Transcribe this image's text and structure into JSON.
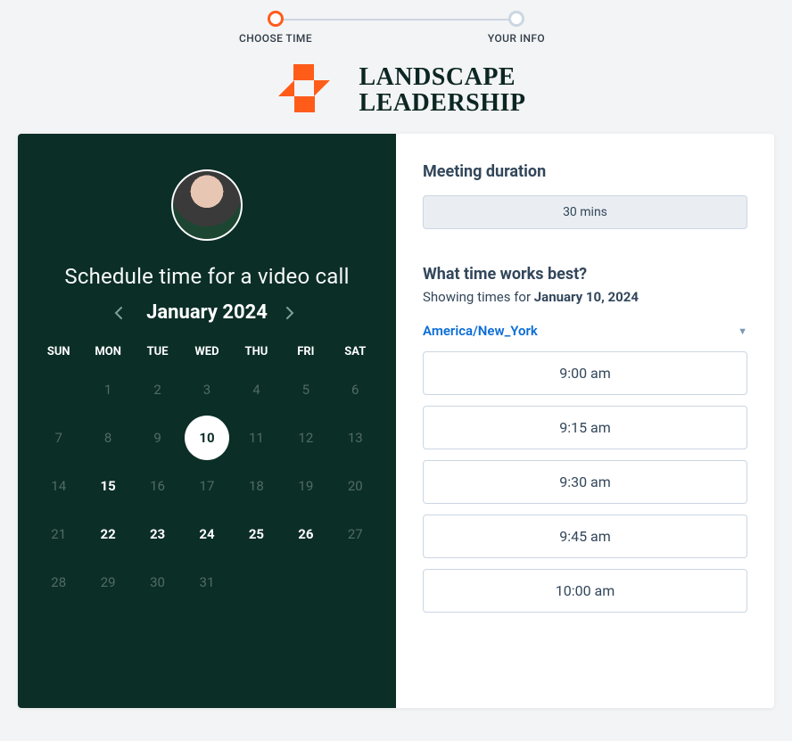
{
  "stepper": {
    "steps": [
      "CHOOSE TIME",
      "YOUR INFO"
    ],
    "active_index": 0
  },
  "brand": {
    "line1": "LANDSCAPE",
    "line2": "LEADERSHIP",
    "accent": "#ff5c1a"
  },
  "left": {
    "heading": "Schedule time for a video call",
    "month_label": "January 2024",
    "weekdays": [
      "SUN",
      "MON",
      "TUE",
      "WED",
      "THU",
      "FRI",
      "SAT"
    ],
    "grid": [
      [
        {
          "n": "",
          "s": ""
        },
        {
          "n": "1",
          "s": "dim"
        },
        {
          "n": "2",
          "s": "dim"
        },
        {
          "n": "3",
          "s": "dim"
        },
        {
          "n": "4",
          "s": "dim"
        },
        {
          "n": "5",
          "s": "dim"
        },
        {
          "n": "6",
          "s": "dim"
        }
      ],
      [
        {
          "n": "7",
          "s": "dim"
        },
        {
          "n": "8",
          "s": "dim"
        },
        {
          "n": "9",
          "s": "dim"
        },
        {
          "n": "10",
          "s": "sel"
        },
        {
          "n": "11",
          "s": "dim"
        },
        {
          "n": "12",
          "s": "dim"
        },
        {
          "n": "13",
          "s": "dim"
        }
      ],
      [
        {
          "n": "14",
          "s": "dim"
        },
        {
          "n": "15",
          "s": "avail"
        },
        {
          "n": "16",
          "s": "dim"
        },
        {
          "n": "17",
          "s": "dim"
        },
        {
          "n": "18",
          "s": "dim"
        },
        {
          "n": "19",
          "s": "dim"
        },
        {
          "n": "20",
          "s": "dim"
        }
      ],
      [
        {
          "n": "21",
          "s": "dim"
        },
        {
          "n": "22",
          "s": "avail"
        },
        {
          "n": "23",
          "s": "avail"
        },
        {
          "n": "24",
          "s": "avail"
        },
        {
          "n": "25",
          "s": "avail"
        },
        {
          "n": "26",
          "s": "avail"
        },
        {
          "n": "27",
          "s": "dim"
        }
      ],
      [
        {
          "n": "28",
          "s": "dim"
        },
        {
          "n": "29",
          "s": "dim"
        },
        {
          "n": "30",
          "s": "dim"
        },
        {
          "n": "31",
          "s": "dim"
        },
        {
          "n": "",
          "s": ""
        },
        {
          "n": "",
          "s": ""
        },
        {
          "n": "",
          "s": ""
        }
      ]
    ]
  },
  "right": {
    "duration_title": "Meeting duration",
    "duration_label": "30 mins",
    "prompt_title": "What time works best?",
    "prompt_prefix": "Showing times for ",
    "selected_date": "January 10, 2024",
    "timezone": "America/New_York",
    "slots": [
      "9:00 am",
      "9:15 am",
      "9:30 am",
      "9:45 am",
      "10:00 am"
    ]
  }
}
